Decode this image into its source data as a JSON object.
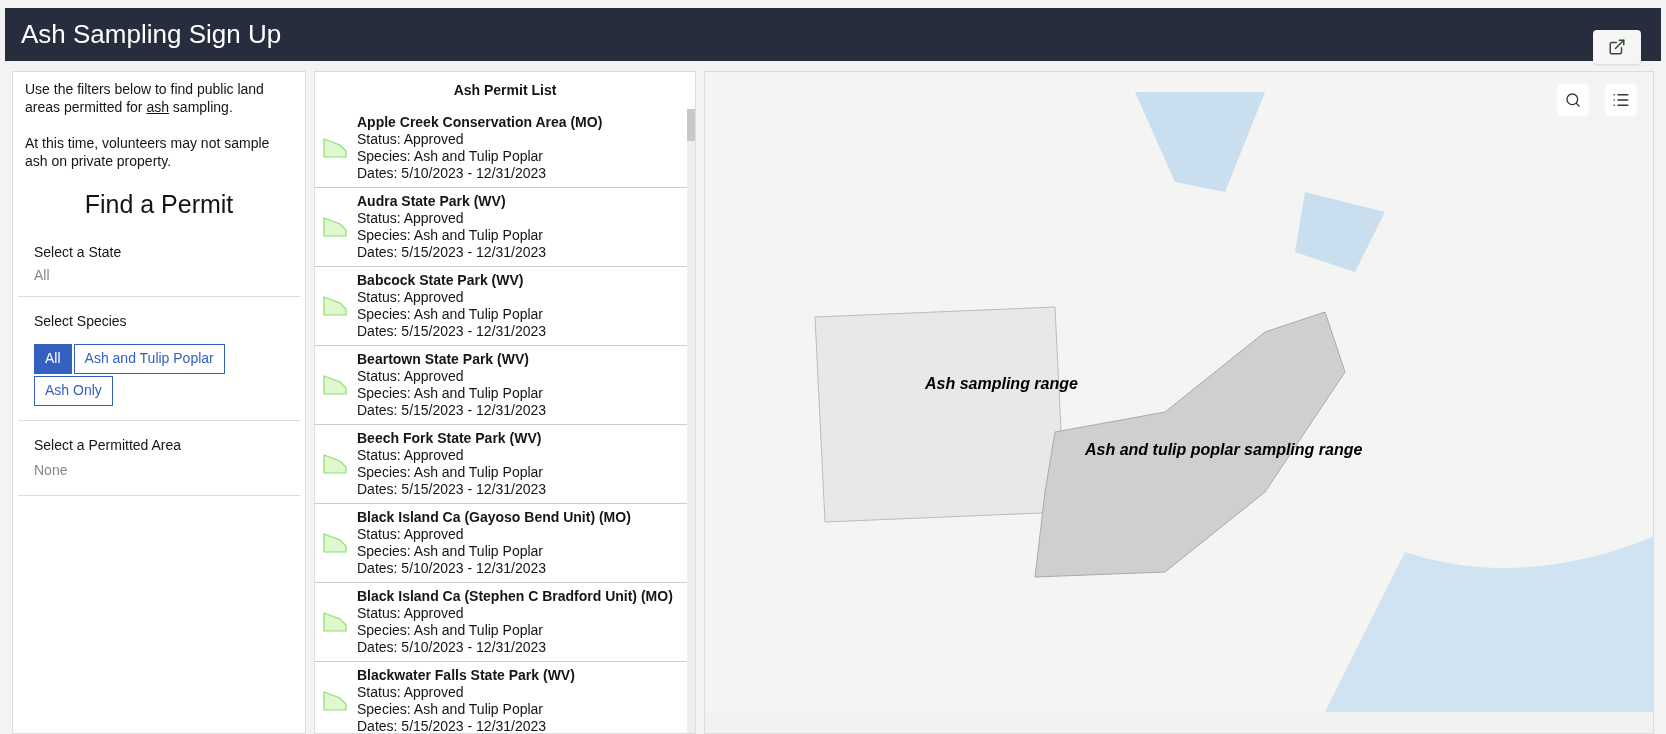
{
  "header": {
    "title": "Ash Sampling Sign Up"
  },
  "sidebar": {
    "intro": "Use the filters below to find public land areas permitted for *ash* sampling.",
    "note": "At this time, volunteers may not sample ash on private property.",
    "heading": "Find a Permit",
    "state_filter": {
      "label": "Select a State",
      "value": "All"
    },
    "species_filter": {
      "label": "Select Species",
      "options": [
        {
          "label": "All",
          "selected": true
        },
        {
          "label": "Ash and Tulip Poplar",
          "selected": false
        },
        {
          "label": "Ash Only",
          "selected": false
        }
      ]
    },
    "area_filter": {
      "label": "Select a Permitted Area",
      "value": "None"
    }
  },
  "permit_list": {
    "title": "Ash Permit List",
    "items": [
      {
        "name": "Apple Creek Conservation Area (MO)",
        "status": "Status: Approved",
        "species": "Species: Ash and Tulip Poplar",
        "dates": "Dates: 5/10/2023 - 12/31/2023"
      },
      {
        "name": "Audra State Park (WV)",
        "status": "Status: Approved",
        "species": "Species: Ash and Tulip Poplar",
        "dates": "Dates: 5/15/2023 - 12/31/2023"
      },
      {
        "name": "Babcock State Park (WV)",
        "status": "Status: Approved",
        "species": "Species: Ash and Tulip Poplar",
        "dates": "Dates: 5/15/2023 - 12/31/2023"
      },
      {
        "name": "Beartown State Park (WV)",
        "status": "Status: Approved",
        "species": "Species: Ash and Tulip Poplar",
        "dates": "Dates: 5/15/2023 - 12/31/2023"
      },
      {
        "name": "Beech Fork State Park (WV)",
        "status": "Status: Approved",
        "species": "Species: Ash and Tulip Poplar",
        "dates": "Dates: 5/15/2023 - 12/31/2023"
      },
      {
        "name": "Black Island Ca (Gayoso Bend Unit) (MO)",
        "status": "Status: Approved",
        "species": "Species: Ash and Tulip Poplar",
        "dates": "Dates: 5/10/2023 - 12/31/2023"
      },
      {
        "name": "Black Island Ca (Stephen C Bradford Unit) (MO)",
        "status": "Status: Approved",
        "species": "Species: Ash and Tulip Poplar",
        "dates": "Dates: 5/10/2023 - 12/31/2023"
      },
      {
        "name": "Blackwater Falls State Park (WV)",
        "status": "Status: Approved",
        "species": "Species: Ash and Tulip Poplar",
        "dates": "Dates: 5/15/2023 - 12/31/2023"
      }
    ]
  },
  "map": {
    "layers": [
      {
        "label": "Ash sampling range"
      },
      {
        "label": "Ash and tulip poplar sampling range"
      }
    ]
  }
}
